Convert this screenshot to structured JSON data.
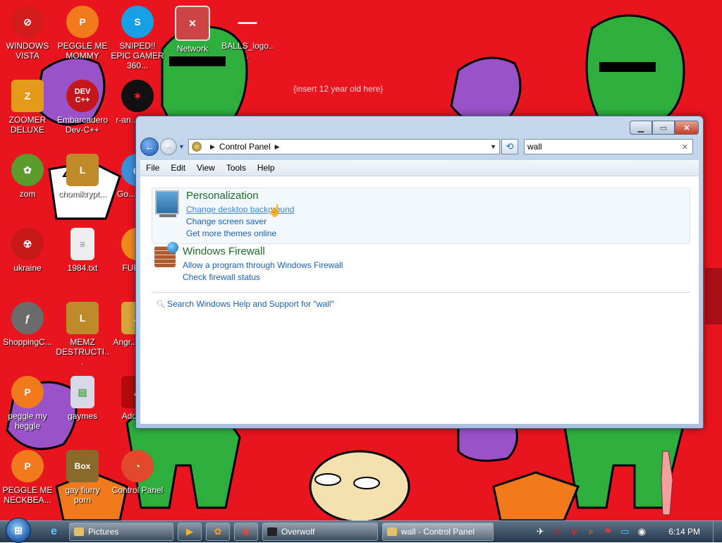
{
  "desktop": {
    "note_text": "{insert 12 year old here}",
    "icons": [
      {
        "label": "WINDOWS VISTA",
        "icon": "no-entry-icon",
        "color": "#d31b1b"
      },
      {
        "label": "PEGGLE ME MOMMY",
        "icon": "peggle-icon",
        "color": "#f07a1c"
      },
      {
        "label": "SNIPED!! EPIC GAMER 360...",
        "icon": "skype-icon",
        "color": "#16a0e6"
      },
      {
        "label": "Network",
        "icon": "network-icon",
        "color": "#cc4444"
      },
      {
        "label": "BALLS_logo...",
        "icon": "image-icon",
        "color": "#444444"
      },
      {
        "label": "ZOOMER DELUXE",
        "icon": "zoomer-icon",
        "color": "#e59a1a"
      },
      {
        "label": "Embarcadero Dev-C++",
        "icon": "devcpp-icon",
        "color": "#c4161c"
      },
      {
        "label": "r-an... par...",
        "icon": "app-icon",
        "color": "#111111"
      },
      {
        "label": "zom",
        "icon": "plant-icon",
        "color": "#5a9b2c"
      },
      {
        "label": "chomikrypt...",
        "icon": "shortcut-icon",
        "color": "#bf8a2a"
      },
      {
        "label": "Go... Chr...",
        "icon": "chrome-icon",
        "color": "#3b8fd9"
      },
      {
        "label": "ukraine",
        "icon": "radiation-icon",
        "color": "#c81919"
      },
      {
        "label": "1984.txt",
        "icon": "text-file-icon",
        "color": "#dddddd"
      },
      {
        "label": "FURR...",
        "icon": "firefox-icon",
        "color": "#f08a1c"
      },
      {
        "label": "ShoppingC...",
        "icon": "flash-icon",
        "color": "#6b6b6b"
      },
      {
        "label": "MEMZ DESTRUCTI...",
        "icon": "shortcut-icon",
        "color": "#bf8a2a"
      },
      {
        "label": "Angr... Sea...",
        "icon": "angry-birds-icon",
        "color": "#d7a33a"
      },
      {
        "label": "peggle my heggle",
        "icon": "peggle-icon",
        "color": "#f07a1c"
      },
      {
        "label": "gaymes",
        "icon": "folder-icon",
        "color": "#d8d8e8"
      },
      {
        "label": "Adobe...",
        "icon": "adobe-icon",
        "color": "#b30b0b"
      },
      {
        "label": "PEGGLE ME NECKBEA...",
        "icon": "peggle-icon",
        "color": "#f07a1c"
      },
      {
        "label": "gay fiurry porn",
        "icon": "box-icon",
        "color": "#8a6a2a"
      },
      {
        "label": "Control Panel",
        "icon": "control-panel-icon",
        "color": "#e04a2a"
      }
    ]
  },
  "window": {
    "breadcrumb_root": "Control Panel",
    "search_value": "wall",
    "menu": [
      "File",
      "Edit",
      "View",
      "Tools",
      "Help"
    ],
    "groups": [
      {
        "title": "Personalization",
        "links": [
          "Change desktop background",
          "Change screen saver",
          "Get more themes online"
        ]
      },
      {
        "title": "Windows Firewall",
        "links": [
          "Allow a program through Windows Firewall",
          "Check firewall status"
        ]
      }
    ],
    "help_link": "Search Windows Help and Support for \"wall\""
  },
  "taskbar": {
    "buttons": [
      "Pictures",
      "Overwolf",
      "wall - Control Panel"
    ],
    "clock": "6:14 PM"
  }
}
